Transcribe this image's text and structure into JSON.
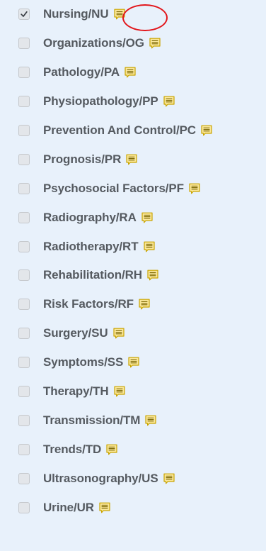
{
  "qualifiers": [
    {
      "label": "Nursing/NU",
      "checked": true
    },
    {
      "label": "Organizations/OG",
      "checked": false
    },
    {
      "label": "Pathology/PA",
      "checked": false
    },
    {
      "label": "Physiopathology/PP",
      "checked": false
    },
    {
      "label": "Prevention And Control/PC",
      "checked": false
    },
    {
      "label": "Prognosis/PR",
      "checked": false
    },
    {
      "label": "Psychosocial Factors/PF",
      "checked": false
    },
    {
      "label": "Radiography/RA",
      "checked": false
    },
    {
      "label": "Radiotherapy/RT",
      "checked": false
    },
    {
      "label": "Rehabilitation/RH",
      "checked": false
    },
    {
      "label": "Risk Factors/RF",
      "checked": false
    },
    {
      "label": "Surgery/SU",
      "checked": false
    },
    {
      "label": "Symptoms/SS",
      "checked": false
    },
    {
      "label": "Therapy/TH",
      "checked": false
    },
    {
      "label": "Transmission/TM",
      "checked": false
    },
    {
      "label": "Trends/TD",
      "checked": false
    },
    {
      "label": "Ultrasonography/US",
      "checked": false
    },
    {
      "label": "Urine/UR",
      "checked": false
    }
  ],
  "icons": {
    "note": "note-icon",
    "check": "checkmark-icon"
  },
  "colors": {
    "background": "#e8f1fb",
    "label_text": "#555a60",
    "note_icon_fill": "#fbe89a",
    "note_icon_stroke": "#c9a400",
    "highlight_ring": "#e2161b"
  }
}
